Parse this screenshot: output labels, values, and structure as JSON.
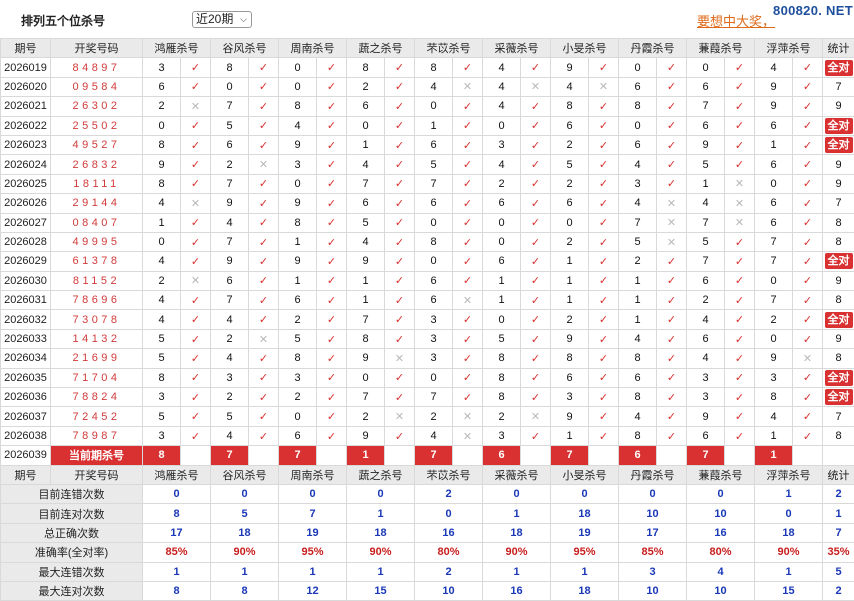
{
  "header": {
    "title": "排列五个位杀号",
    "range_selected": "近20期",
    "promo": "要想中大奖，",
    "watermark": "800820. NET"
  },
  "columns": {
    "issue": "期号",
    "draw": "开奖号码",
    "experts": [
      "鸿雁杀号",
      "谷风杀号",
      "周南杀号",
      "蔬之杀号",
      "芣苡杀号",
      "采薇杀号",
      "小旻杀号",
      "丹霞杀号",
      "蒹葭杀号",
      "浮萍杀号"
    ],
    "stat": "统计"
  },
  "rows": [
    {
      "issue": "2026019",
      "draw": "84897",
      "kills": [
        3,
        8,
        0,
        8,
        8,
        4,
        9,
        0,
        0,
        4
      ],
      "hits": [
        1,
        1,
        1,
        1,
        1,
        1,
        1,
        1,
        1,
        1
      ],
      "stat": "全对"
    },
    {
      "issue": "2026020",
      "draw": "09584",
      "kills": [
        6,
        0,
        0,
        2,
        4,
        4,
        4,
        6,
        6,
        9
      ],
      "hits": [
        1,
        1,
        1,
        1,
        0,
        0,
        0,
        1,
        1,
        1
      ],
      "stat": "7"
    },
    {
      "issue": "2026021",
      "draw": "26302",
      "kills": [
        2,
        7,
        8,
        6,
        0,
        4,
        8,
        8,
        7,
        9
      ],
      "hits": [
        0,
        1,
        1,
        1,
        1,
        1,
        1,
        1,
        1,
        1
      ],
      "stat": "9"
    },
    {
      "issue": "2026022",
      "draw": "25502",
      "kills": [
        0,
        5,
        4,
        0,
        1,
        0,
        6,
        0,
        6,
        6
      ],
      "hits": [
        1,
        1,
        1,
        1,
        1,
        1,
        1,
        1,
        1,
        1
      ],
      "stat": "全对"
    },
    {
      "issue": "2026023",
      "draw": "49527",
      "kills": [
        8,
        6,
        9,
        1,
        6,
        3,
        2,
        6,
        9,
        1
      ],
      "hits": [
        1,
        1,
        1,
        1,
        1,
        1,
        1,
        1,
        1,
        1
      ],
      "stat": "全对"
    },
    {
      "issue": "2026024",
      "draw": "26832",
      "kills": [
        9,
        2,
        3,
        4,
        5,
        4,
        5,
        4,
        5,
        6
      ],
      "hits": [
        1,
        0,
        1,
        1,
        1,
        1,
        1,
        1,
        1,
        1
      ],
      "stat": "9"
    },
    {
      "issue": "2026025",
      "draw": "18111",
      "kills": [
        8,
        7,
        0,
        7,
        7,
        2,
        2,
        3,
        1,
        0
      ],
      "hits": [
        1,
        1,
        1,
        1,
        1,
        1,
        1,
        1,
        0,
        1
      ],
      "stat": "9"
    },
    {
      "issue": "2026026",
      "draw": "29144",
      "kills": [
        4,
        9,
        9,
        6,
        6,
        6,
        6,
        4,
        4,
        6
      ],
      "hits": [
        0,
        1,
        1,
        1,
        1,
        1,
        1,
        0,
        0,
        1
      ],
      "stat": "7"
    },
    {
      "issue": "2026027",
      "draw": "08407",
      "kills": [
        1,
        4,
        8,
        5,
        0,
        0,
        0,
        7,
        7,
        6
      ],
      "hits": [
        1,
        1,
        1,
        1,
        1,
        1,
        1,
        0,
        0,
        1
      ],
      "stat": "8"
    },
    {
      "issue": "2026028",
      "draw": "49995",
      "kills": [
        0,
        7,
        1,
        4,
        8,
        0,
        2,
        5,
        5,
        7
      ],
      "hits": [
        1,
        1,
        1,
        1,
        1,
        1,
        1,
        0,
        1,
        1
      ],
      "stat": "8"
    },
    {
      "issue": "2026029",
      "draw": "61378",
      "kills": [
        4,
        9,
        9,
        9,
        0,
        6,
        1,
        2,
        7,
        7
      ],
      "hits": [
        1,
        1,
        1,
        1,
        1,
        1,
        1,
        1,
        1,
        1
      ],
      "stat": "全对"
    },
    {
      "issue": "2026030",
      "draw": "81152",
      "kills": [
        2,
        6,
        1,
        1,
        6,
        1,
        1,
        1,
        6,
        0
      ],
      "hits": [
        0,
        1,
        1,
        1,
        1,
        1,
        1,
        1,
        1,
        1
      ],
      "stat": "9"
    },
    {
      "issue": "2026031",
      "draw": "78696",
      "kills": [
        4,
        7,
        6,
        1,
        6,
        1,
        1,
        1,
        2,
        7
      ],
      "hits": [
        1,
        1,
        1,
        1,
        0,
        1,
        1,
        1,
        1,
        1
      ],
      "stat": "8"
    },
    {
      "issue": "2026032",
      "draw": "73078",
      "kills": [
        4,
        4,
        2,
        7,
        3,
        0,
        2,
        1,
        4,
        2
      ],
      "hits": [
        1,
        1,
        1,
        1,
        1,
        1,
        1,
        1,
        1,
        1
      ],
      "stat": "全对"
    },
    {
      "issue": "2026033",
      "draw": "14132",
      "kills": [
        5,
        2,
        5,
        8,
        3,
        5,
        9,
        4,
        6,
        0
      ],
      "hits": [
        1,
        0,
        1,
        1,
        1,
        1,
        1,
        1,
        1,
        1
      ],
      "stat": "9"
    },
    {
      "issue": "2026034",
      "draw": "21699",
      "kills": [
        5,
        4,
        8,
        9,
        3,
        8,
        8,
        8,
        4,
        9
      ],
      "hits": [
        1,
        1,
        1,
        0,
        1,
        1,
        1,
        1,
        1,
        0
      ],
      "stat": "8"
    },
    {
      "issue": "2026035",
      "draw": "71704",
      "kills": [
        8,
        3,
        3,
        0,
        0,
        8,
        6,
        6,
        3,
        3
      ],
      "hits": [
        1,
        1,
        1,
        1,
        1,
        1,
        1,
        1,
        1,
        1
      ],
      "stat": "全对"
    },
    {
      "issue": "2026036",
      "draw": "78824",
      "kills": [
        3,
        2,
        2,
        7,
        7,
        8,
        3,
        8,
        3,
        8
      ],
      "hits": [
        1,
        1,
        1,
        1,
        1,
        1,
        1,
        1,
        1,
        1
      ],
      "stat": "全对"
    },
    {
      "issue": "2026037",
      "draw": "72452",
      "kills": [
        5,
        5,
        0,
        2,
        2,
        2,
        9,
        4,
        9,
        4
      ],
      "hits": [
        1,
        1,
        1,
        0,
        0,
        0,
        1,
        1,
        1,
        1
      ],
      "stat": "7"
    },
    {
      "issue": "2026038",
      "draw": "78987",
      "kills": [
        3,
        4,
        6,
        9,
        4,
        3,
        1,
        8,
        6,
        1
      ],
      "hits": [
        1,
        1,
        1,
        1,
        0,
        1,
        1,
        1,
        1,
        1
      ],
      "stat": "8"
    }
  ],
  "current": {
    "issue": "2026039",
    "label": "当前期杀号",
    "kills": [
      "8",
      "7",
      "7",
      "1",
      "7",
      "6",
      "7",
      "6",
      "7",
      "1"
    ]
  },
  "summary": [
    {
      "label": "目前连错次数",
      "values": [
        "0",
        "0",
        "0",
        "0",
        "2",
        "0",
        "0",
        "0",
        "0",
        "1",
        "2"
      ]
    },
    {
      "label": "目前连对次数",
      "values": [
        "8",
        "5",
        "7",
        "1",
        "0",
        "1",
        "18",
        "10",
        "10",
        "0",
        "1"
      ]
    },
    {
      "label": "总正确次数",
      "values": [
        "17",
        "18",
        "19",
        "18",
        "16",
        "18",
        "19",
        "17",
        "16",
        "18",
        "7"
      ]
    },
    {
      "label": "准确率(全对率)",
      "values": [
        "85%",
        "90%",
        "95%",
        "90%",
        "80%",
        "90%",
        "95%",
        "85%",
        "80%",
        "90%",
        "35%"
      ]
    },
    {
      "label": "最大连错次数",
      "values": [
        "1",
        "1",
        "1",
        "1",
        "2",
        "1",
        "1",
        "3",
        "4",
        "1",
        "5"
      ]
    },
    {
      "label": "最大连对次数",
      "values": [
        "8",
        "8",
        "12",
        "15",
        "10",
        "16",
        "18",
        "10",
        "10",
        "15",
        "2"
      ]
    }
  ],
  "glyphs": {
    "ok": "✓",
    "bad": "✕"
  },
  "colors": {
    "accent": "#d93131",
    "hit": "#d9302c",
    "miss": "#b8b8b8",
    "summary": "#1a38b8",
    "header_bg": "#eaeaea"
  }
}
